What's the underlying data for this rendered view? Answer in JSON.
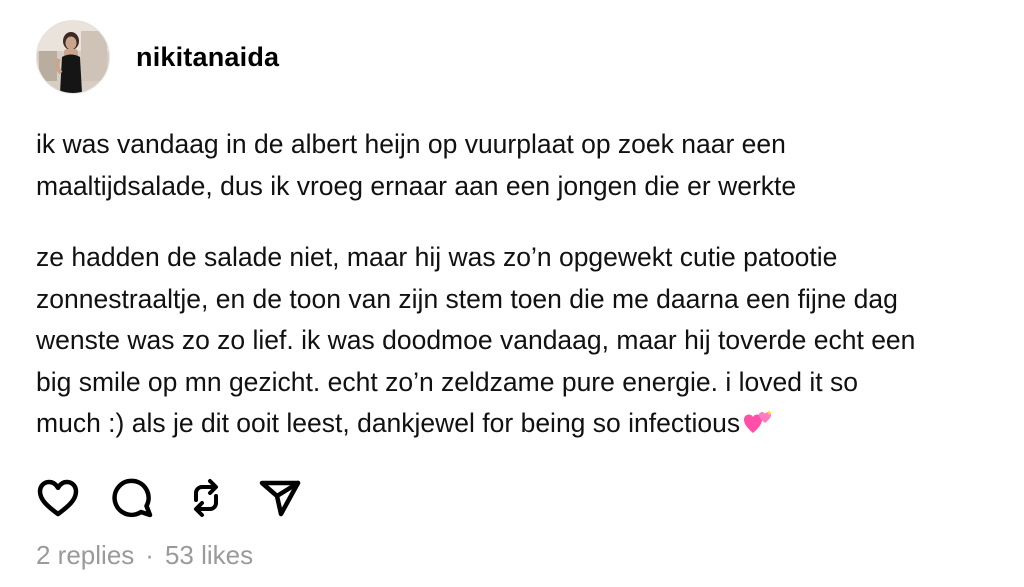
{
  "post": {
    "author": {
      "username": "nikitanaida",
      "avatar_icon": "profile-photo-avatar"
    },
    "paragraphs": [
      "ik was vandaag in de albert heijn op vuurplaat op zoek naar een\nmaaltijdsalade, dus ik vroeg ernaar aan een jongen die er werkte",
      "ze hadden de salade niet, maar hij was zo’n opgewekt cutie patootie\nzonnestraaltje, en de toon van zijn stem toen die me daarna een fijne dag\nwenste was zo zo lief. ik was doodmoe vandaag, maar hij toverde echt een\nbig smile op mn gezicht. echt zo’n zeldzame pure energie. i loved it so\nmuch :) als je dit ooit leest, dankjewel for being so infectious"
    ],
    "trailing_emoji": "two-hearts-emoji",
    "actions": [
      {
        "name": "like",
        "icon": "heart-icon"
      },
      {
        "name": "reply",
        "icon": "comment-icon"
      },
      {
        "name": "repost",
        "icon": "repost-icon"
      },
      {
        "name": "share",
        "icon": "send-icon"
      }
    ],
    "stats": {
      "replies": "2 replies",
      "separator": "·",
      "likes": "53 likes"
    },
    "colors": {
      "text": "#111111",
      "muted": "#9a9a9a",
      "emoji_pink": "#ff4fa8"
    }
  }
}
